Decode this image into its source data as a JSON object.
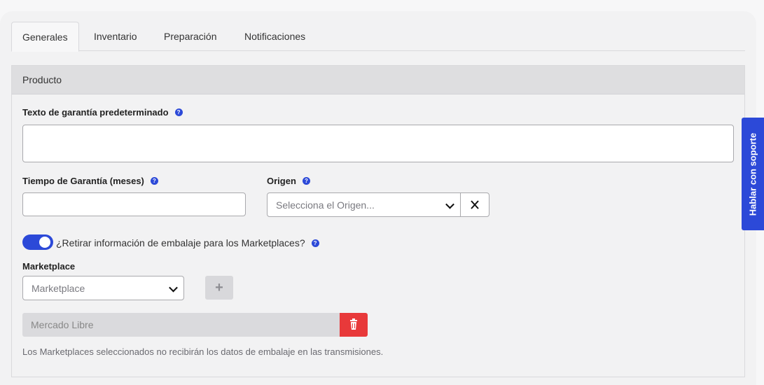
{
  "tabs": [
    "Generales",
    "Inventario",
    "Preparación",
    "Notificaciones"
  ],
  "panel_title": "Producto",
  "warranty_text": {
    "label": "Texto de garantía predeterminado",
    "help": "?"
  },
  "warranty_time": {
    "label": "Tiempo de Garantía (meses)",
    "help": "?"
  },
  "origin": {
    "label": "Origen",
    "help": "?",
    "placeholder": "Selecciona el Origen..."
  },
  "remove_packaging": {
    "label": "¿Retirar información de embalaje para los Marketplaces?",
    "enabled": true,
    "help": "?"
  },
  "marketplace": {
    "label": "Marketplace",
    "placeholder": "Marketplace",
    "add_glyph": "+"
  },
  "selected_marketplaces": [
    {
      "name": "Mercado Libre"
    }
  ],
  "note": "Los Marketplaces seleccionados no recibirán los datos de embalaje en las transmisiones.",
  "support_tab": "Hablar con soporte",
  "colors": {
    "accent": "#2c49d8",
    "danger": "#e8393a"
  }
}
